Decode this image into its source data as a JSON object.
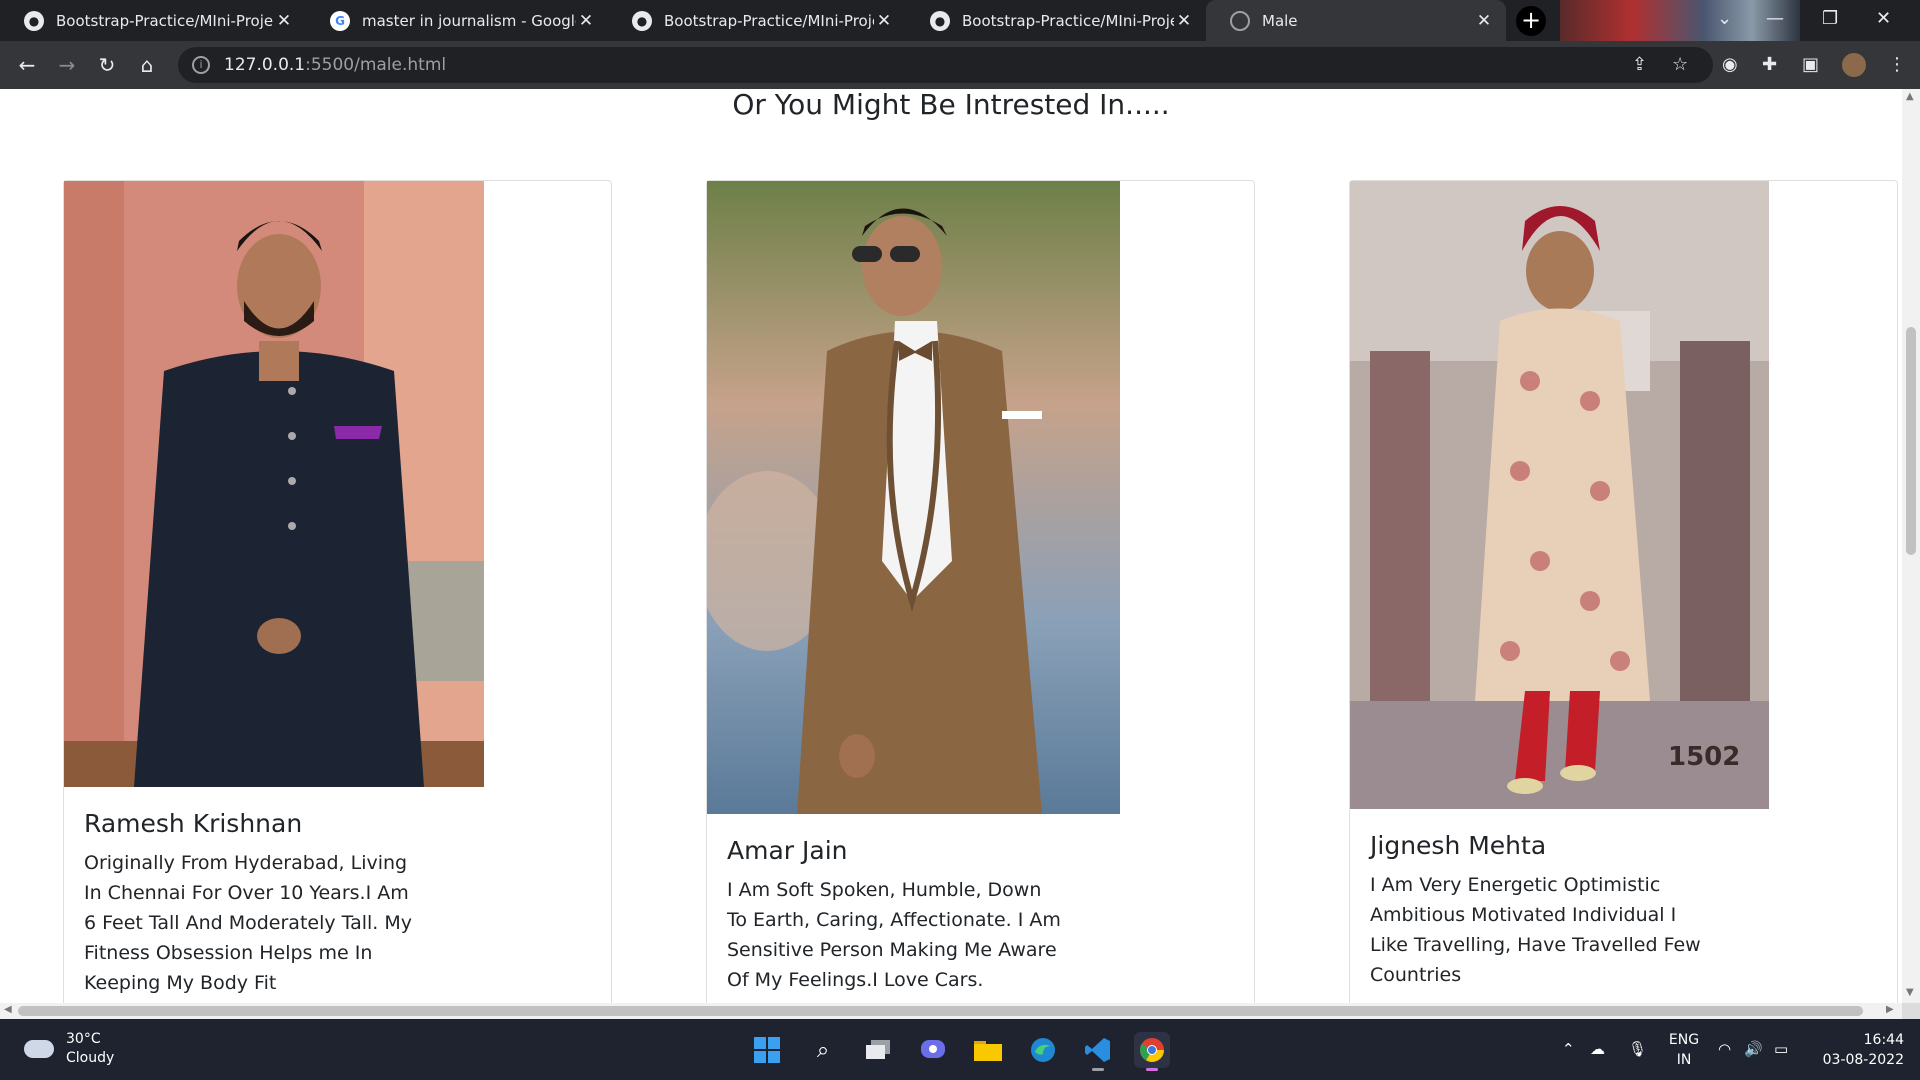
{
  "browser": {
    "tabs": [
      {
        "title": "Bootstrap-Practice/MIni-Project_",
        "icon": "github-icon"
      },
      {
        "title": "master in journalism - Google Se",
        "icon": "google-icon"
      },
      {
        "title": "Bootstrap-Practice/MIni-Project_",
        "icon": "github-icon"
      },
      {
        "title": "Bootstrap-Practice/MIni-Project_",
        "icon": "github-icon"
      },
      {
        "title": "Male",
        "icon": "globe-icon"
      }
    ],
    "close_glyph": "✕",
    "new_tab_glyph": "+",
    "url_host": "127.0.0.1",
    "url_path": ":5500/male.html"
  },
  "page": {
    "heading": "Or You Might Be Intrested In.....",
    "cards": [
      {
        "name": "Ramesh Krishnan",
        "bio": "Originally From Hyderabad, Living In Chennai For Over 10 Years.I Am 6 Feet Tall And Moderately Tall. My Fitness Obsession Helps me In Keeping My Body Fit",
        "photo_colors": [
          "#d98a7a",
          "#1c2333",
          "#9a6a4a"
        ]
      },
      {
        "name": "Amar Jain",
        "bio": "I Am Soft Spoken, Humble, Down To Earth, Caring, Affectionate. I Am Sensitive Person Making Me Aware Of My Feelings.I Love Cars.",
        "photo_colors": [
          "#7a8a5a",
          "#8a6642",
          "#c8b8a0"
        ]
      },
      {
        "name": "Jignesh Mehta",
        "bio": "I Am Very Energetic Optimistic Ambitious Motivated Individual I Like Travelling, Have Travelled Few Countries",
        "photo_colors": [
          "#b8a8a0",
          "#e0c8b0",
          "#c41e28"
        ],
        "photo_caption": "1502"
      }
    ]
  },
  "taskbar": {
    "temperature": "30°C",
    "weather": "Cloudy",
    "lang_top": "ENG",
    "lang_bottom": "IN",
    "time": "16:44",
    "date": "03-08-2022"
  }
}
